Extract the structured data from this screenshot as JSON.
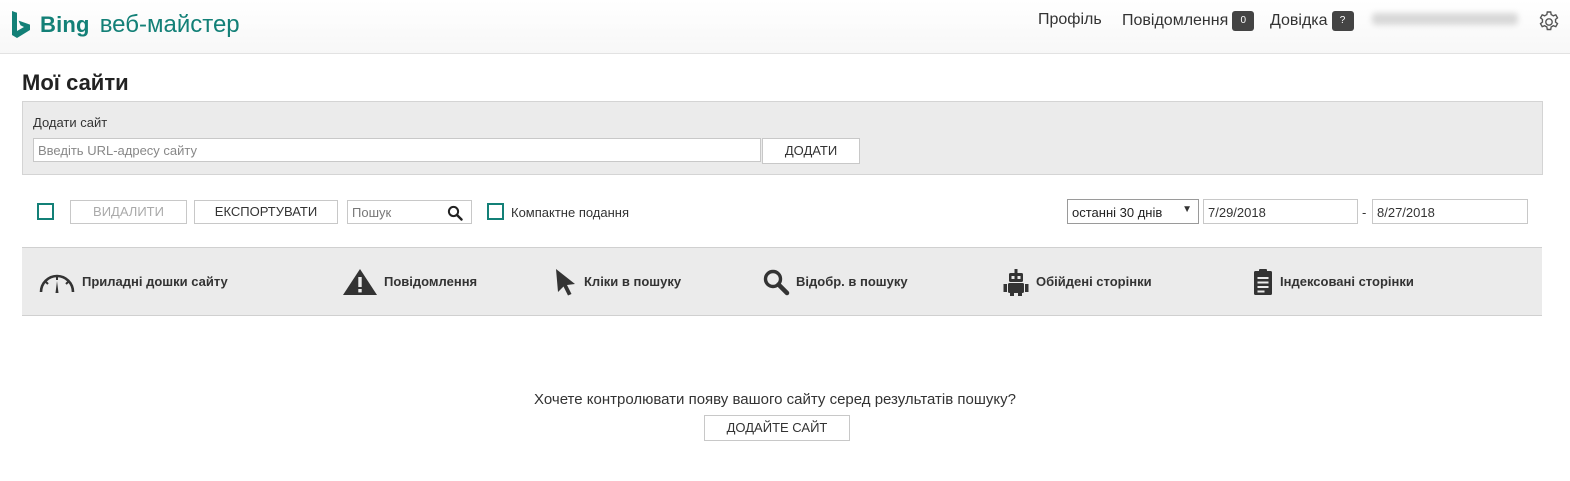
{
  "header": {
    "brand": "Bing",
    "product": "веб-майстер",
    "nav": {
      "profile": "Профіль",
      "messages": "Повідомлення",
      "messages_count": "0",
      "help": "Довідка",
      "help_badge": "?"
    }
  },
  "page": {
    "title": "Мої сайти"
  },
  "add_site": {
    "label": "Додати сайт",
    "placeholder": "Введіть URL-адресу сайту",
    "button": "ДОДАТИ"
  },
  "toolbar": {
    "delete": "ВИДАЛИТИ",
    "export": "ЕКСПОРТУВАТИ",
    "search_placeholder": "Пошук",
    "compact_view": "Компактне подання",
    "range": "останні 30 днів",
    "date_from": "7/29/2018",
    "date_separator": "-",
    "date_to": "8/27/2018"
  },
  "columns": [
    {
      "label": "Приладні дошки сайту",
      "icon": "gauge-icon"
    },
    {
      "label": "Повідомлення",
      "icon": "warning-icon"
    },
    {
      "label": "Кліки в пошуку",
      "icon": "cursor-icon"
    },
    {
      "label": "Відобр. в пошуку",
      "icon": "search-icon"
    },
    {
      "label": "Обійдені сторінки",
      "icon": "robot-icon"
    },
    {
      "label": "Індексовані сторінки",
      "icon": "clipboard-icon"
    }
  ],
  "empty_state": {
    "message": "Хочете контролювати появу вашого сайту серед результатів пошуку?",
    "button": "ДОДАЙТЕ САЙТ"
  },
  "colors": {
    "accent": "#138077",
    "panel": "#ebebeb",
    "badge": "#444444"
  }
}
